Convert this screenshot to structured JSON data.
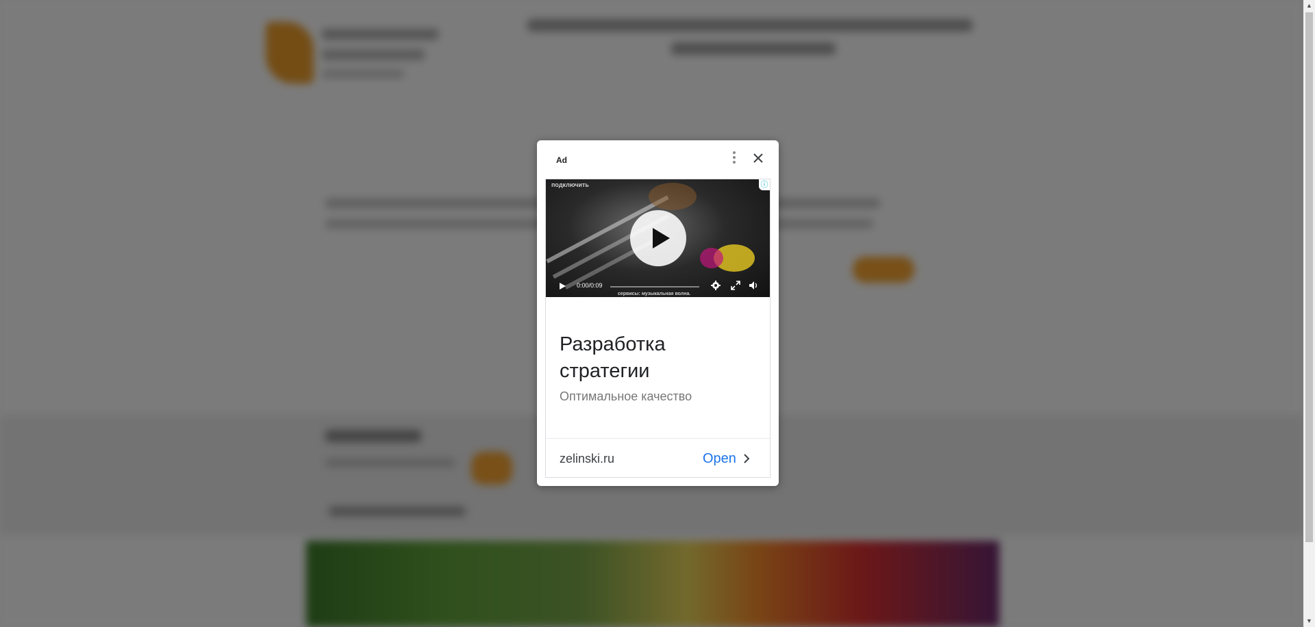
{
  "ad": {
    "label": "Ad",
    "video": {
      "overlay_text": "подключить",
      "info_glyph": "ⓘ",
      "time": "0:00/0:09",
      "music_caption": "сервисы: музыкальная волна.",
      "controls": [
        "play-icon",
        "gear-icon",
        "fullscreen-icon",
        "volume-icon"
      ]
    },
    "headline": "Разработка стратегии",
    "subline": "Оптимальное качество",
    "domain": "zelinski.ru",
    "open_label": "Open"
  },
  "colors": {
    "open_link": "#1a73e8",
    "info_icon": "#00aecd",
    "backdrop": "rgba(0,0,0,0.5)"
  }
}
